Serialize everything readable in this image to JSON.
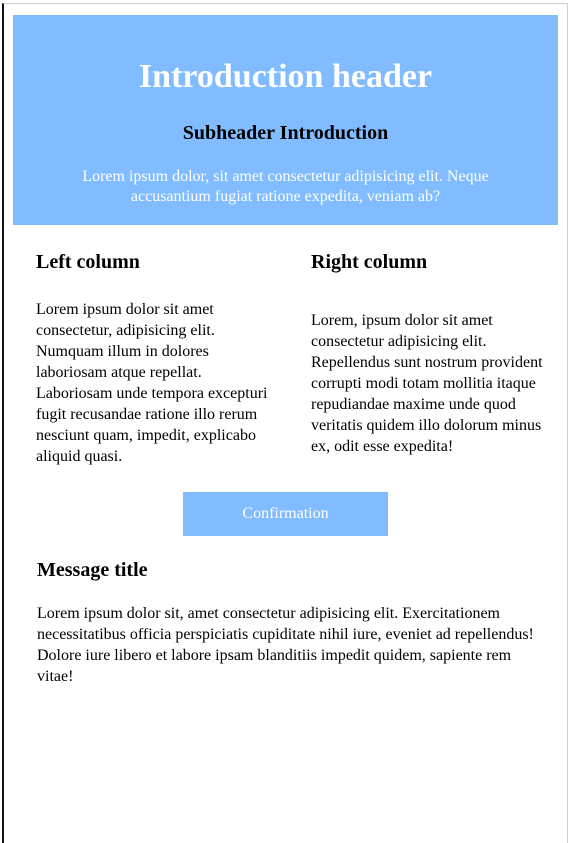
{
  "header": {
    "title": "Introduction header",
    "subtitle": "Subheader Introduction",
    "text": "Lorem ipsum dolor, sit amet consectetur adipisicing elit. Neque accusantium fugiat ratione expedita, veniam ab?"
  },
  "left_column": {
    "title": "Left column",
    "text": "Lorem ipsum dolor sit amet consectetur, adipisicing elit. Numquam illum in dolores laboriosam atque repellat. Laboriosam unde tempora excepturi fugit recusandae ratione illo rerum nesciunt quam, impedit, explicabo aliquid quasi."
  },
  "right_column": {
    "title": "Right column",
    "text": "Lorem, ipsum dolor sit amet consectetur adipisicing elit. Repellendus sunt nostrum provident corrupti modi totam mollitia itaque repudiandae maxime unde quod veritatis quidem illo dolorum minus ex, odit esse expedita!"
  },
  "confirm_button": {
    "label": "Confirmation"
  },
  "message": {
    "title": "Message title",
    "text": "Lorem ipsum dolor sit, amet consectetur adipisicing elit. Exercitationem necessitatibus officia perspiciatis cupiditate nihil iure, eveniet ad repellendus! Dolore iure libero et labore ipsam blanditiis impedit quidem, sapiente rem vitae!"
  },
  "colors": {
    "accent": "#80bcff",
    "hero_text": "#ffffff"
  }
}
